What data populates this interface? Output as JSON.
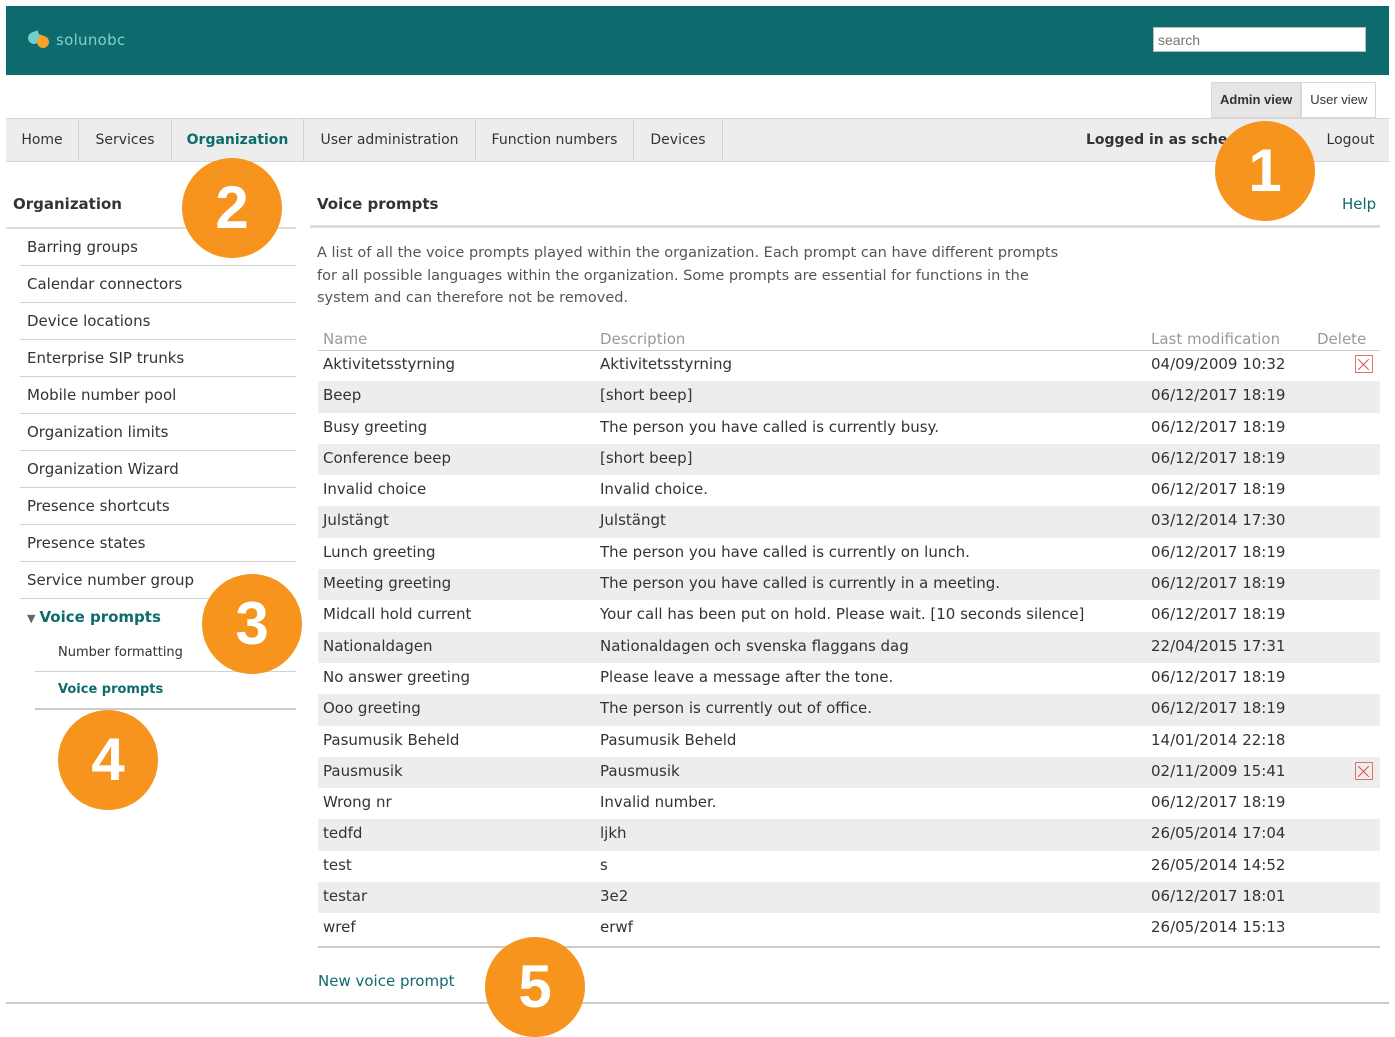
{
  "header": {
    "logo_text": "solunobc",
    "search_placeholder": "search"
  },
  "view_tabs": {
    "admin": "Admin view",
    "user": "User view"
  },
  "nav": {
    "items": [
      "Home",
      "Services",
      "Organization",
      "User administration",
      "Function numbers",
      "Devices"
    ],
    "active": "Organization",
    "logged_in": "Logged in as sche",
    "logout": "Logout"
  },
  "sidebar": {
    "title": "Organization",
    "items": [
      "Barring groups",
      "Calendar connectors",
      "Device locations",
      "Enterprise SIP trunks",
      "Mobile number pool",
      "Organization limits",
      "Organization Wizard",
      "Presence shortcuts",
      "Presence states",
      "Service number group"
    ],
    "expanded": "Voice prompts",
    "subitems": [
      "Number formatting",
      "Voice prompts"
    ],
    "active_subitem": "Voice prompts"
  },
  "main": {
    "title": "Voice prompts",
    "help": "Help",
    "intro": "A list of all the voice prompts played within the organization. Each prompt can have different prompts for all possible languages within the organization. Some prompts are essential for functions in the system and can therefore not be removed.",
    "columns": {
      "name": "Name",
      "description": "Description",
      "last_modification": "Last modification",
      "delete": "Delete"
    },
    "rows": [
      {
        "name": "Aktivitetsstyrning",
        "description": "Aktivitetsstyrning",
        "modified": "04/09/2009 10:32",
        "deletable": true
      },
      {
        "name": "Beep",
        "description": "[short beep]",
        "modified": "06/12/2017 18:19",
        "deletable": false
      },
      {
        "name": "Busy greeting",
        "description": "The person you have called is currently busy.",
        "modified": "06/12/2017 18:19",
        "deletable": false
      },
      {
        "name": "Conference beep",
        "description": "[short beep]",
        "modified": "06/12/2017 18:19",
        "deletable": false
      },
      {
        "name": "Invalid choice",
        "description": "Invalid choice.",
        "modified": "06/12/2017 18:19",
        "deletable": false
      },
      {
        "name": "Julstängt",
        "description": "Julstängt",
        "modified": "03/12/2014 17:30",
        "deletable": false
      },
      {
        "name": "Lunch greeting",
        "description": "The person you have called is currently on lunch.",
        "modified": "06/12/2017 18:19",
        "deletable": false
      },
      {
        "name": "Meeting greeting",
        "description": "The person you have called is currently in a meeting.",
        "modified": "06/12/2017 18:19",
        "deletable": false
      },
      {
        "name": "Midcall hold current",
        "description": "Your call has been put on hold. Please wait. [10 seconds silence]",
        "modified": "06/12/2017 18:19",
        "deletable": false
      },
      {
        "name": "Nationaldagen",
        "description": "Nationaldagen och svenska flaggans dag",
        "modified": "22/04/2015 17:31",
        "deletable": false
      },
      {
        "name": "No answer greeting",
        "description": "Please leave a message after the tone.",
        "modified": "06/12/2017 18:19",
        "deletable": false
      },
      {
        "name": "Ooo greeting",
        "description": "The person is currently out of office.",
        "modified": "06/12/2017 18:19",
        "deletable": false
      },
      {
        "name": "Pasumusik Beheld",
        "description": "Pasumusik Beheld",
        "modified": "14/01/2014 22:18",
        "deletable": false
      },
      {
        "name": "Pausmusik",
        "description": "Pausmusik",
        "modified": "02/11/2009 15:41",
        "deletable": true
      },
      {
        "name": "Wrong nr",
        "description": "Invalid number.",
        "modified": "06/12/2017 18:19",
        "deletable": false
      },
      {
        "name": "tedfd",
        "description": "ljkh",
        "modified": "26/05/2014 17:04",
        "deletable": false
      },
      {
        "name": "test",
        "description": "s",
        "modified": "26/05/2014 14:52",
        "deletable": false
      },
      {
        "name": "testar",
        "description": "3e2",
        "modified": "06/12/2017 18:01",
        "deletable": false
      },
      {
        "name": "wref",
        "description": "erwf",
        "modified": "26/05/2014 15:13",
        "deletable": false
      }
    ],
    "new_link": "New voice prompt"
  },
  "badges": [
    "1",
    "2",
    "3",
    "4",
    "5"
  ],
  "colors": {
    "brand": "#0e6b6d",
    "badge": "#f7941d",
    "delete": "#e04040"
  }
}
